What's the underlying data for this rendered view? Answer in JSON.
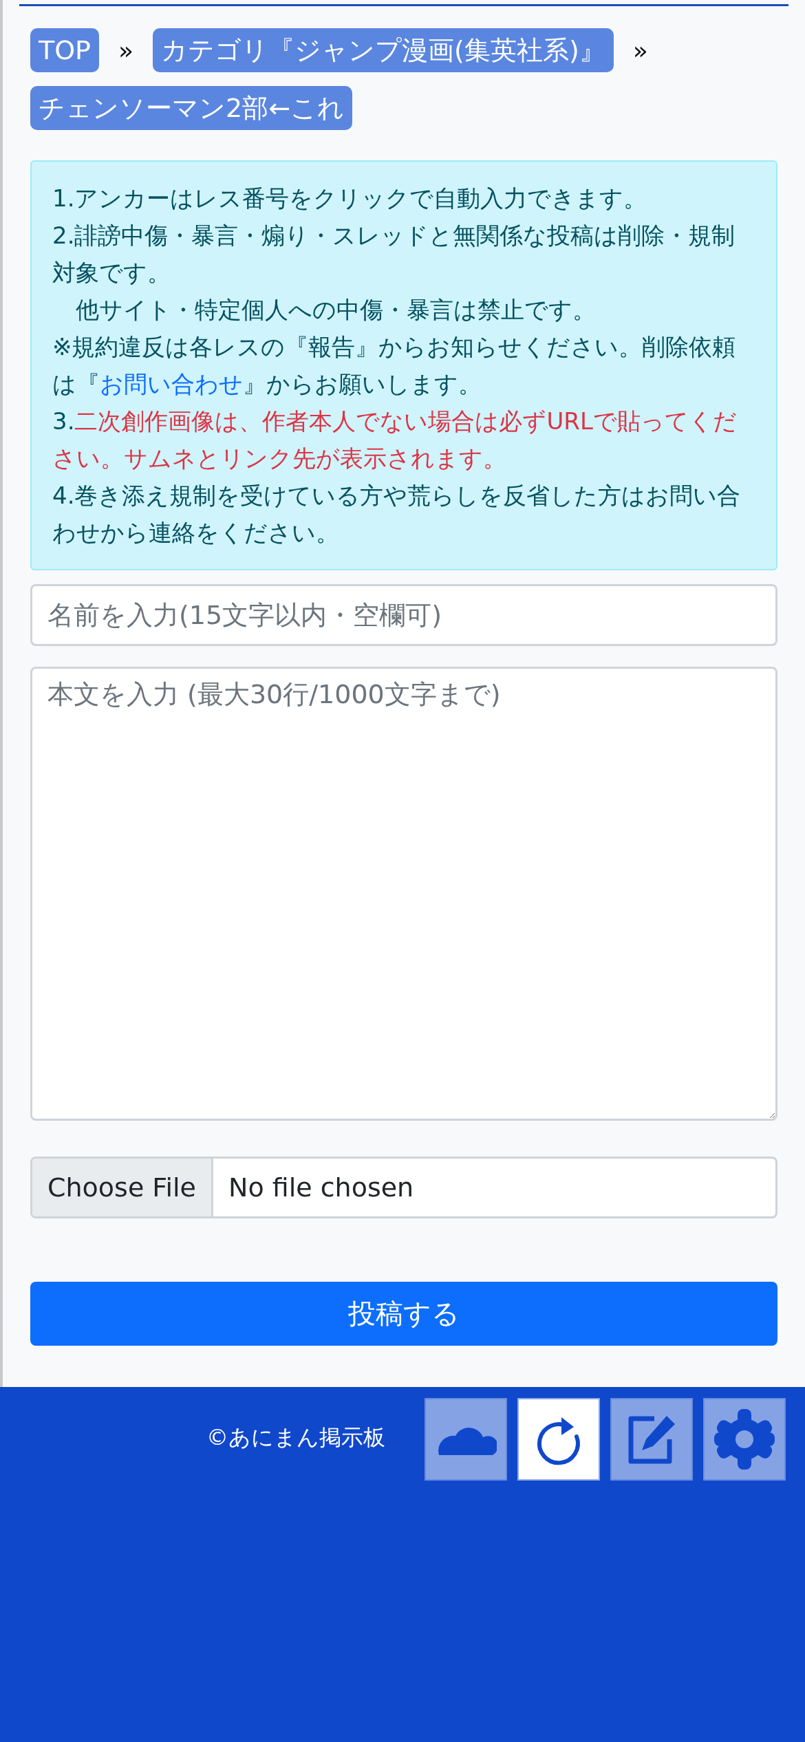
{
  "breadcrumb": {
    "items": [
      {
        "label": "TOP"
      },
      {
        "label": "カテゴリ『ジャンプ漫画(集英社系)』"
      },
      {
        "label": "チェンソーマン2部←これ"
      }
    ],
    "separator": "»"
  },
  "notice": {
    "paragraphs": [
      {
        "parts": [
          {
            "kind": "text",
            "text": "1.アンカーはレス番号をクリックで自動入力できます。"
          }
        ]
      },
      {
        "parts": [
          {
            "kind": "text",
            "text": "2.誹謗中傷・暴言・煽り・スレッドと無関係な投稿は削除・規制対象です。"
          }
        ]
      },
      {
        "parts": [
          {
            "kind": "text",
            "text": "　他サイト・特定個人への中傷・暴言は禁止です。"
          }
        ]
      },
      {
        "parts": [
          {
            "kind": "text",
            "text": "※規約違反は各レスの『報告』からお知らせください。削除依頼は『"
          },
          {
            "kind": "link",
            "text": "お問い合わせ"
          },
          {
            "kind": "text",
            "text": "』からお願いします。"
          }
        ]
      },
      {
        "parts": [
          {
            "kind": "text",
            "text": "3."
          },
          {
            "kind": "warning",
            "text": "二次創作画像は、作者本人でない場合は必ずURLで貼ってください。サムネとリンク先が表示されます。"
          }
        ]
      },
      {
        "parts": [
          {
            "kind": "text",
            "text": "4.巻き添え規制を受けている方や荒らしを反省した方はお問い合わせから連絡をください。"
          }
        ]
      }
    ]
  },
  "form": {
    "name_field": {
      "placeholder": "名前を入力(15文字以内・空欄可)"
    },
    "body_field": {
      "placeholder": "本文を入力 (最大30行/1000文字まで)"
    },
    "file_button": "Choose File",
    "file_status": "No file chosen",
    "submit": "投稿する"
  },
  "footer": {
    "copyright": "©あにまん掲示板"
  },
  "floating_buttons": [
    {
      "active": false
    },
    {
      "active": true
    },
    {
      "active": false
    },
    {
      "active": false
    }
  ]
}
